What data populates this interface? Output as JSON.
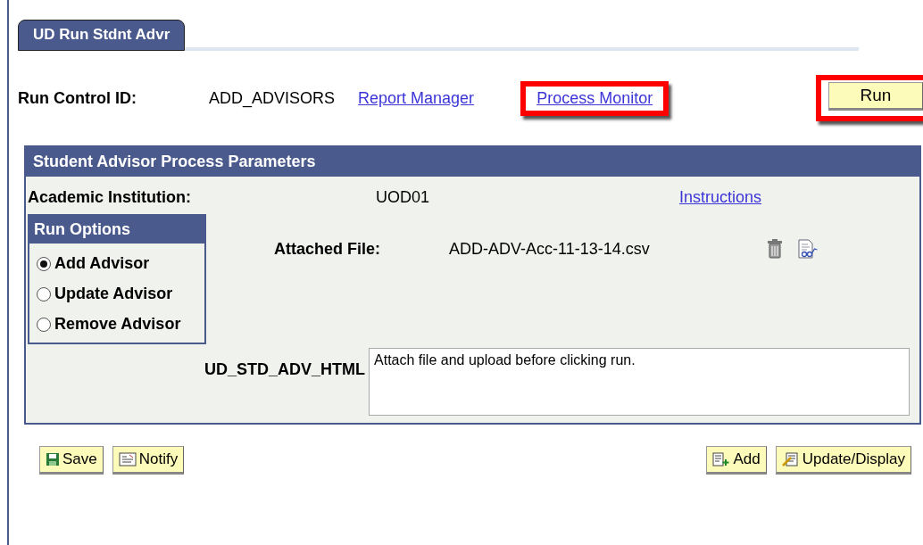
{
  "tabs": [
    {
      "label": "UD Run Stdnt Advr",
      "selected": true
    }
  ],
  "run_control": {
    "label": "Run Control ID:",
    "value": "ADD_ADVISORS",
    "links": [
      {
        "label": "Report Manager",
        "highlighted": false
      },
      {
        "label": "Process Monitor",
        "highlighted": true
      }
    ],
    "run_button": {
      "label": "Run",
      "highlighted": true
    }
  },
  "panel": {
    "title": "Student Advisor Process Parameters",
    "institution": {
      "label": "Academic Institution:",
      "value": "UOD01"
    },
    "instructions_link": "Instructions",
    "run_options": {
      "title": "Run Options",
      "options": [
        {
          "label": "Add Advisor",
          "selected": true
        },
        {
          "label": "Update Advisor",
          "selected": false
        },
        {
          "label": "Remove Advisor",
          "selected": false
        }
      ]
    },
    "attached_file": {
      "label": "Attached File:",
      "value": "ADD-ADV-Acc-11-13-14.csv"
    },
    "html_field": {
      "label": "UD_STD_ADV_HTML",
      "value": "Attach file and upload before clicking run."
    }
  },
  "footer_left": [
    {
      "label": "Save",
      "kind": "save"
    },
    {
      "label": "Notify",
      "kind": "notify"
    }
  ],
  "footer_right": [
    {
      "label": "Add",
      "kind": "add"
    },
    {
      "label": "Update/Display",
      "kind": "update"
    }
  ]
}
